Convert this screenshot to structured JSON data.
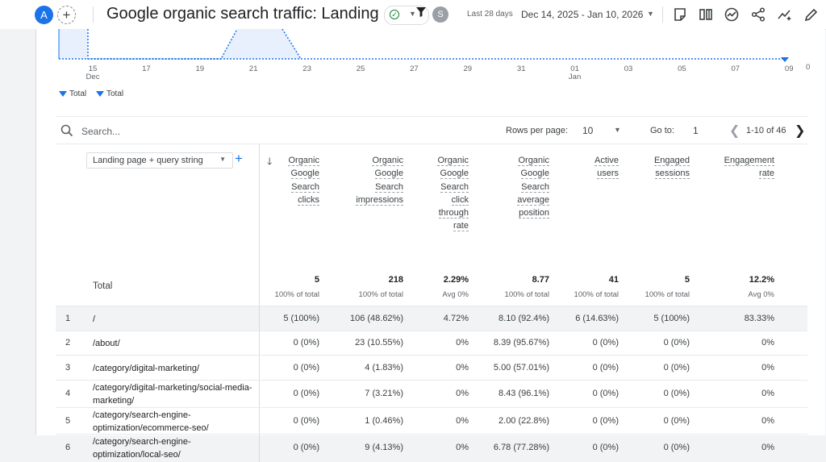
{
  "header": {
    "avatar_letter": "A",
    "add_icon": "plus-circle-icon",
    "title": "Google organic search traffic: Landing p...",
    "status_icon": "check-circle-icon",
    "user_avatar_letter": "S",
    "date_label": "Last 28 days",
    "date_range": "Dec 14, 2025 - Jan 10, 2026",
    "tools": [
      "edit-note-icon",
      "compare-columns-icon",
      "insights-icon",
      "share-icon",
      "trend-sparkle-icon",
      "pencil-icon"
    ]
  },
  "chart": {
    "x_ticks": [
      "15",
      "17",
      "19",
      "21",
      "23",
      "25",
      "27",
      "29",
      "31",
      "01",
      "03",
      "05",
      "07",
      "09"
    ],
    "x_tick_months": {
      "15": "Dec",
      "01": "Jan"
    },
    "y_right_label": "0",
    "legend": [
      "Total",
      "Total"
    ],
    "line_color": "#1a73e8",
    "fill_color": "#e8f0fe"
  },
  "toolbar": {
    "search_placeholder": "Search...",
    "rows_per_page_label": "Rows per page:",
    "rows_per_page_value": "10",
    "goto_label": "Go to:",
    "goto_value": "1",
    "pager_text": "1-10 of 46"
  },
  "table": {
    "dimension_label": "Landing page + query string",
    "columns": [
      {
        "lines": [
          "Organic",
          "Google",
          "Search",
          "clicks"
        ]
      },
      {
        "lines": [
          "Organic",
          "Google",
          "Search",
          "impressions"
        ]
      },
      {
        "lines": [
          "Organic",
          "Google",
          "Search",
          "click",
          "through",
          "rate"
        ]
      },
      {
        "lines": [
          "Organic",
          "Google",
          "Search",
          "average",
          "position"
        ]
      },
      {
        "lines": [
          "Active",
          "users"
        ]
      },
      {
        "lines": [
          "Engaged",
          "sessions"
        ]
      },
      {
        "lines": [
          "Engagement",
          "rate"
        ]
      }
    ],
    "total_label": "Total",
    "totals": [
      {
        "value": "5",
        "sub": "100% of total"
      },
      {
        "value": "218",
        "sub": "100% of total"
      },
      {
        "value": "2.29%",
        "sub": "Avg 0%"
      },
      {
        "value": "8.77",
        "sub": "100% of total"
      },
      {
        "value": "41",
        "sub": "100% of total"
      },
      {
        "value": "5",
        "sub": "100% of total"
      },
      {
        "value": "12.2%",
        "sub": "Avg 0%"
      }
    ],
    "rows": [
      {
        "idx": "1",
        "dim": "/",
        "cells": [
          "5 (100%)",
          "106 (48.62%)",
          "4.72%",
          "8.10 (92.4%)",
          "6 (14.63%)",
          "5 (100%)",
          "83.33%"
        ]
      },
      {
        "idx": "2",
        "dim": "/about/",
        "cells": [
          "0 (0%)",
          "23 (10.55%)",
          "0%",
          "8.39 (95.67%)",
          "0 (0%)",
          "0 (0%)",
          "0%"
        ]
      },
      {
        "idx": "3",
        "dim": "/category/digital-marketing/",
        "cells": [
          "0 (0%)",
          "4 (1.83%)",
          "0%",
          "5.00 (57.01%)",
          "0 (0%)",
          "0 (0%)",
          "0%"
        ]
      },
      {
        "idx": "4",
        "dim": "/category/digital-marketing/social-media-marketing/",
        "cells": [
          "0 (0%)",
          "7 (3.21%)",
          "0%",
          "8.43 (96.1%)",
          "0 (0%)",
          "0 (0%)",
          "0%"
        ]
      },
      {
        "idx": "5",
        "dim": "/category/search-engine-optimization/ecommerce-seo/",
        "cells": [
          "0 (0%)",
          "1 (0.46%)",
          "0%",
          "2.00 (22.8%)",
          "0 (0%)",
          "0 (0%)",
          "0%"
        ]
      },
      {
        "idx": "6",
        "dim": "/category/search-engine-optimization/local-seo/",
        "cells": [
          "0 (0%)",
          "9 (4.13%)",
          "0%",
          "6.78 (77.28%)",
          "0 (0%)",
          "0 (0%)",
          "0%"
        ]
      }
    ]
  }
}
